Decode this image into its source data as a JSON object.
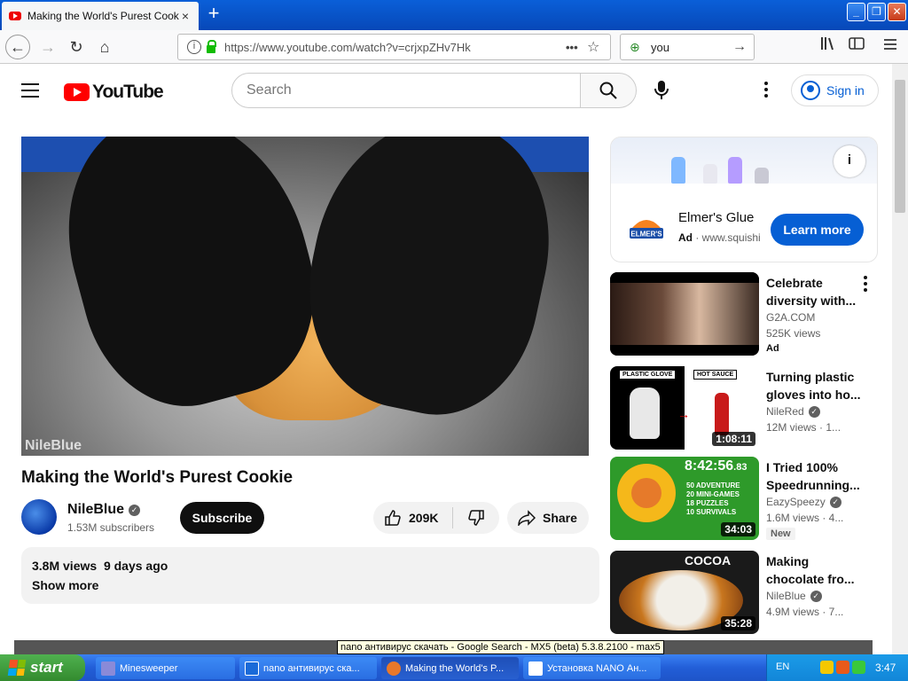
{
  "browser": {
    "tab_title": "Making the World's Purest Cookie",
    "tab_close": "×",
    "new_tab": "+",
    "url": "https://www.youtube.com/watch?v=crjxpZHv7Hk",
    "url_dots": "•••",
    "bookmark_star": "☆",
    "search_value": "you",
    "search_go": "→",
    "nav_back": "←",
    "nav_forward": "→",
    "nav_reload": "↻",
    "nav_home": "⌂",
    "win_min": "_",
    "win_max": "❐",
    "win_close": "✕"
  },
  "youtube": {
    "logo_text": "YouTube",
    "search_placeholder": "Search",
    "signin_label": "Sign in"
  },
  "video": {
    "watermark": "NileBlue",
    "title": "Making the World's Purest Cookie",
    "channel": "NileBlue",
    "subscribers": "1.53M subscribers",
    "subscribe_label": "Subscribe",
    "likes": "209K",
    "share_label": "Share",
    "views": "3.8M views",
    "age": "9 days ago",
    "show_more": "Show more"
  },
  "ad": {
    "name": "Elmer's Glue",
    "badge": "Ad",
    "domain": "www.squishies",
    "cta": "Learn more",
    "logo_text": "ELMER'S",
    "info": "i"
  },
  "recommendations": [
    {
      "title": "Celebrate diversity with...",
      "channel": "G2A.COM",
      "views": "525K views",
      "badge": "Ad",
      "duration": ""
    },
    {
      "title": "Turning plastic gloves into ho...",
      "channel": "NileRed",
      "views": "12M views · 1...",
      "badge": "",
      "duration": "1:08:11",
      "thumb_left": "PLASTIC GLOVE",
      "thumb_right": "HOT SAUCE"
    },
    {
      "title": "I Tried 100% Speedrunning...",
      "channel": "EazySpeezy",
      "views": "1.6M views · 4...",
      "badge": "New",
      "duration": "34:03",
      "thumb_timer": "8:42:56",
      "thumb_timer_ms": ".83",
      "thumb_lines": [
        "50 ADVENTURE",
        "20 MINI-GAMES",
        "18 PUZZLES",
        "10 SURVIVALS"
      ]
    },
    {
      "title": "Making chocolate fro...",
      "channel": "NileBlue",
      "views": "4.9M views · 7...",
      "badge": "",
      "duration": "35:28",
      "thumb_label": "COCOA"
    }
  ],
  "tooltip": "nano антивирус скачать - Google Search - MX5 (beta) 5.3.8.2100 - max5",
  "taskbar": {
    "start": "start",
    "tasks": [
      "Minesweeper",
      "nano антивирус ска...",
      "Making the World's P...",
      "Установка NANO Ан..."
    ],
    "lang": "EN",
    "clock": "3:47"
  },
  "colors": {
    "youtube_red": "#ff0000",
    "link_blue": "#065fd4",
    "xp_blue": "#245edb",
    "xp_green": "#3c9a3c"
  }
}
